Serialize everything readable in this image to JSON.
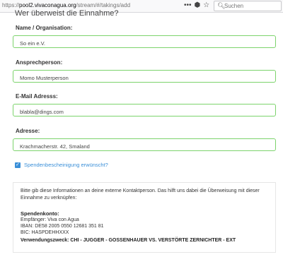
{
  "browser": {
    "url_prefix": "https://",
    "url_host": "pool2.vivaconagua.org",
    "url_path": "/stream/#/takings/add",
    "search_placeholder": "Suchen",
    "icons": [
      "more-icon",
      "pocket-icon",
      "bookmark-star-icon"
    ]
  },
  "form": {
    "heading": "Wer überweist die Einnahme?",
    "fields": [
      {
        "label": "Name / Organisation:",
        "value": "So ein e.V."
      },
      {
        "label": "Ansprechperson:",
        "value": "Momo Musterperson"
      },
      {
        "label": "E-Mail Adresss:",
        "value": "blabla@dings.com"
      },
      {
        "label": "Adresse:",
        "value": "Krachmacherstr. 42, Smaland"
      }
    ],
    "receipt_checkbox": {
      "label": "Spendenbescheinigung erwünscht?",
      "checked": true
    }
  },
  "info": {
    "text": "Bitte gib diese Informationen an deine externe Kontaktperson. Das hilft uns dabei die Überweisung mit dieser Einnahme zu verknüpfen:",
    "account_title": "Spendenkonto:",
    "recipient": "Empfänger: Viva con Agua",
    "iban": "IBAN: DE58 2005 0550 12681 351 81",
    "bic": "BIC: HASPDEHHXXX",
    "purpose_label": "Verwendungszweck:",
    "purpose_value": "CHI - JUGGER - GOSSENHAUER VS. VERSTÖRTE ZERNICHTER - EXT"
  },
  "colors": {
    "field_border": "#7cd36c",
    "accent": "#3a8fd8"
  }
}
